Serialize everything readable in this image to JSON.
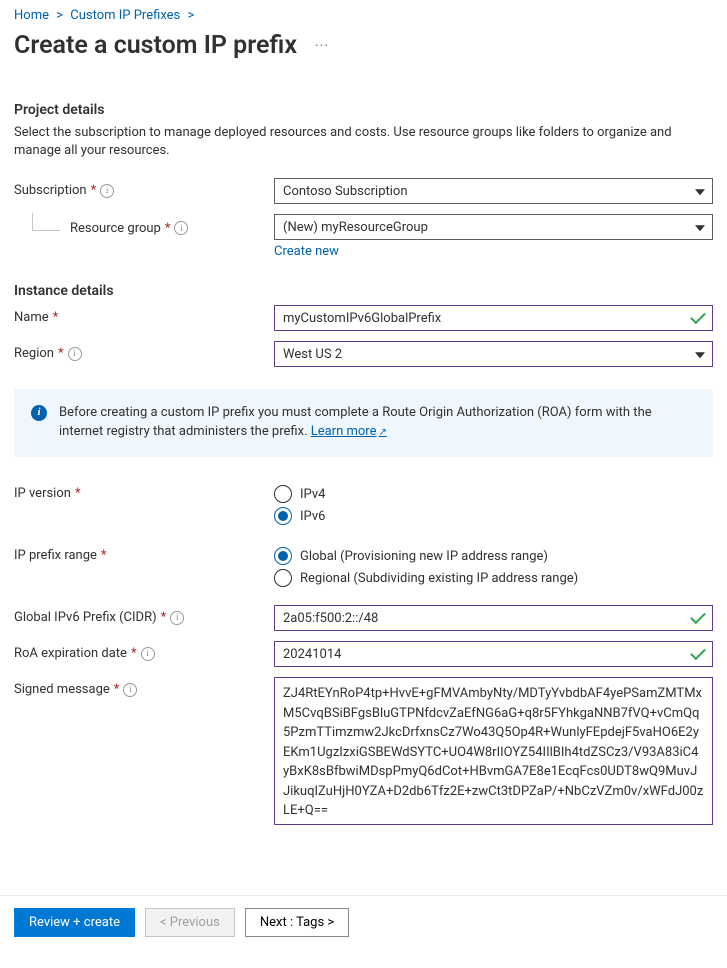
{
  "breadcrumb": {
    "home": "Home",
    "mid": "Custom IP Prefixes"
  },
  "page_title": "Create a custom IP prefix",
  "sections": {
    "project": {
      "header": "Project details",
      "desc": "Select the subscription to manage deployed resources and costs. Use resource groups like folders to organize and manage all your resources.",
      "sub_label": "Subscription",
      "sub_value": "Contoso Subscription",
      "rg_label": "Resource group",
      "rg_value": "(New) myResourceGroup",
      "create_new": "Create new"
    },
    "instance": {
      "header": "Instance details",
      "name_label": "Name",
      "name_value": "myCustomIPv6GlobalPrefix",
      "region_label": "Region",
      "region_value": "West US 2"
    }
  },
  "callout": {
    "text_a": "Before creating a custom IP prefix you must complete a Route Origin Authorization (ROA) form with the internet registry that administers the prefix. ",
    "learn_more": "Learn more"
  },
  "ip": {
    "version_label": "IP version",
    "v4": "IPv4",
    "v6": "IPv6",
    "range_label": "IP prefix range",
    "global": "Global (Provisioning new IP address range)",
    "regional": "Regional (Subdividing existing IP address range)",
    "cidr_label": "Global IPv6 Prefix (CIDR)",
    "cidr_value": "2a05:f500:2::/48",
    "roa_label": "RoA expiration date",
    "roa_value": "20241014",
    "signed_label": "Signed message",
    "signed_value": "ZJ4RtEYnRoP4tp+HvvE+gFMVAmbyNty/MDTyYvbdbAF4yePSamZMTMxM5CvqBSiBFgsBluGTPNfdcvZaEfNG6aG+q8r5FYhkgaNNB7fVQ+vCmQq5PzmTTimzmw2JkcDrfxnsCz7Wo43Q5Op4R+WunlyFEpdejF5vaHO6E2yEKm1UgzIzxiGSBEWdSYTC+UO4W8rIIOYZ54IIlBIh4tdZSCz3/V93A83iC4yBxK8sBfbwiMDspPmyQ6dCot+HBvmGA7E8e1EcqFcs0UDT8wQ9MuvJJikuqIZuHjH0YZA+D2db6Tfz2E+zwCt3tDPZaP/+NbCzVZm0v/xWFdJ00zLE+Q=="
  },
  "footer": {
    "review": "Review + create",
    "prev": "< Previous",
    "next": "Next : Tags >"
  }
}
